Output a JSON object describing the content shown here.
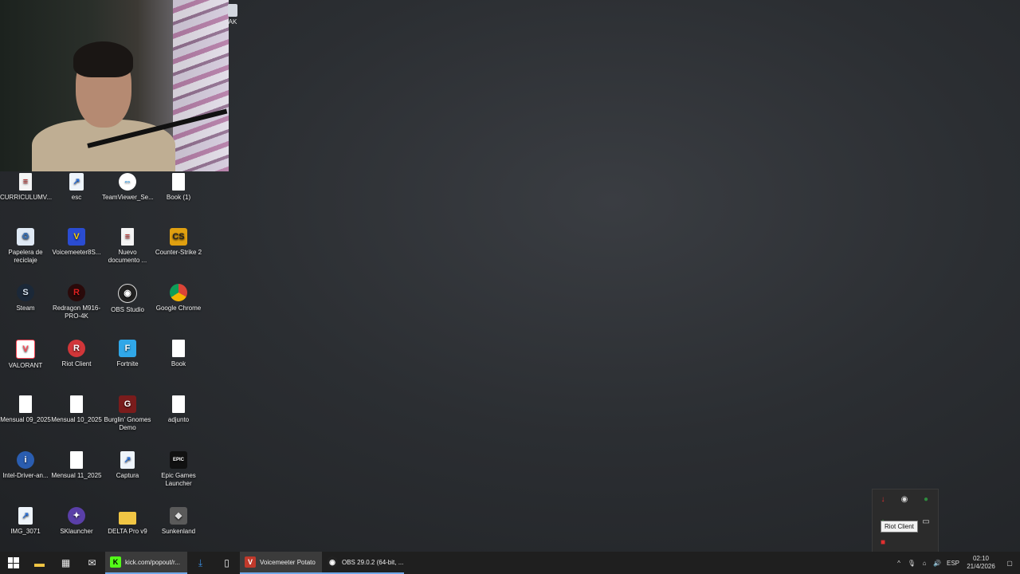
{
  "overlay": {
    "badge_label": "AK"
  },
  "desktop": {
    "icons": [
      {
        "label": "CURRICULUMV...",
        "glyph": "≡"
      },
      {
        "label": "esc",
        "glyph": "↗"
      },
      {
        "label": "TeamViewer_Se...",
        "glyph": "⇔"
      },
      {
        "label": "Book (1)",
        "glyph": ""
      },
      {
        "label": "Papelera de reciclaje",
        "glyph": "♻"
      },
      {
        "label": "Voicemeeter8S...",
        "glyph": "V"
      },
      {
        "label": "Nuevo documento ...",
        "glyph": "≡"
      },
      {
        "label": "Counter-Strike 2",
        "glyph": "CS"
      },
      {
        "label": "Steam",
        "glyph": "S"
      },
      {
        "label": "Redragon M916-PRO-4K",
        "glyph": "R"
      },
      {
        "label": "OBS Studio",
        "glyph": "◉"
      },
      {
        "label": "Google Chrome",
        "glyph": ""
      },
      {
        "label": "VALORANT",
        "glyph": "V"
      },
      {
        "label": "Riot Client",
        "glyph": "R"
      },
      {
        "label": "Fortnite",
        "glyph": "F"
      },
      {
        "label": "Book",
        "glyph": ""
      },
      {
        "label": "Mensual 09_2025",
        "glyph": ""
      },
      {
        "label": "Mensual 10_2025",
        "glyph": ""
      },
      {
        "label": "Burglin' Gnomes Demo",
        "glyph": "G"
      },
      {
        "label": "adjunto",
        "glyph": ""
      },
      {
        "label": "Intel-Driver-an...",
        "glyph": "i"
      },
      {
        "label": "Mensual 11_2025",
        "glyph": ""
      },
      {
        "label": "Captura",
        "glyph": "↗"
      },
      {
        "label": "Epic Games Launcher",
        "glyph": "EPIC"
      },
      {
        "label": "IMG_3071",
        "glyph": "↗"
      },
      {
        "label": "SKlauncher",
        "glyph": "✦"
      },
      {
        "label": "DELTA Pro v9",
        "glyph": ""
      },
      {
        "label": "Sunkenland",
        "glyph": "◆"
      }
    ]
  },
  "tray_popup": {
    "tooltip": "Riot Client"
  },
  "taskbar": {
    "apps": [
      {
        "label": "kick.com/popout/r...",
        "glyph": "K",
        "color": "#53fc18"
      },
      {
        "label": "Voicemeeter Potato",
        "glyph": "V",
        "color": "#c0392b"
      },
      {
        "label": "OBS 29.0.2 (64-bit, ...",
        "glyph": "◉",
        "color": "#222222"
      }
    ],
    "language": "ESP",
    "time": "02:10",
    "date": "21/4/2026"
  }
}
